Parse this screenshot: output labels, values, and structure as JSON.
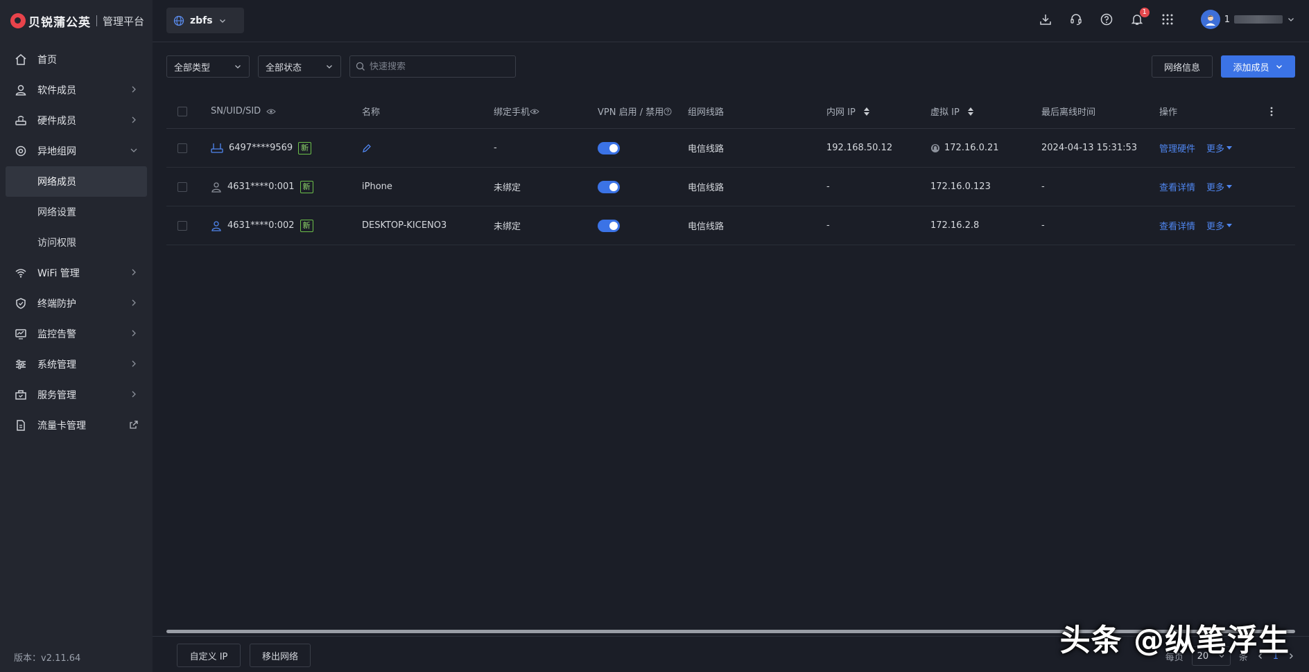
{
  "brand": {
    "name": "贝锐蒲公英",
    "subtitle": "管理平台"
  },
  "sidebar": {
    "items": [
      {
        "label": "首页",
        "icon": "home-icon"
      },
      {
        "label": "软件成员",
        "icon": "user-icon"
      },
      {
        "label": "硬件成员",
        "icon": "router-icon"
      },
      {
        "label": "异地组网",
        "icon": "network-icon"
      },
      {
        "label": "WiFi 管理",
        "icon": "wifi-icon"
      },
      {
        "label": "终端防护",
        "icon": "shield-icon"
      },
      {
        "label": "监控告警",
        "icon": "monitor-icon"
      },
      {
        "label": "系统管理",
        "icon": "settings-sliders-icon"
      },
      {
        "label": "服务管理",
        "icon": "service-icon"
      },
      {
        "label": "流量卡管理",
        "icon": "simcard-icon"
      }
    ],
    "sub_items": [
      {
        "label": "网络成员"
      },
      {
        "label": "网络设置"
      },
      {
        "label": "访问权限"
      }
    ],
    "version": "版本：v2.11.64"
  },
  "topbar": {
    "network_name": "zbfs",
    "notification_count": "1",
    "user_initial": "1"
  },
  "filters": {
    "type": "全部类型",
    "status": "全部状态",
    "search_placeholder": "快速搜索"
  },
  "actions": {
    "net_info": "网络信息",
    "add_member": "添加成员"
  },
  "table": {
    "headers": {
      "sn": "SN/UID/SID",
      "name": "名称",
      "phone": "绑定手机",
      "vpn": "VPN 启用 / 禁用",
      "line": "组网线路",
      "lan": "内网 IP",
      "vip": "虚拟 IP",
      "last": "最后离线时间",
      "ops": "操作"
    },
    "new_tag": "新",
    "more": "更多",
    "rows": [
      {
        "sn": "6497****9569",
        "name": "",
        "phone": "-",
        "vpn": true,
        "line": "电信线路",
        "lan": "192.168.50.12",
        "vip": "172.16.0.21",
        "last": "2024-04-13 15:31:53",
        "op": "管理硬件"
      },
      {
        "sn": "4631****0:001",
        "name": "iPhone",
        "phone": "未绑定",
        "vpn": true,
        "line": "电信线路",
        "lan": "-",
        "vip": "172.16.0.123",
        "last": "-",
        "op": "查看详情"
      },
      {
        "sn": "4631****0:002",
        "name": "DESKTOP-KICENO3",
        "phone": "未绑定",
        "vpn": true,
        "line": "电信线路",
        "lan": "-",
        "vip": "172.16.2.8",
        "last": "-",
        "op": "查看详情"
      }
    ]
  },
  "footer": {
    "custom_ip": "自定义 IP",
    "move_out": "移出网络",
    "per_page_label": "每页",
    "page_size": "20",
    "unit": "条",
    "current_page": "1"
  },
  "watermark": "头条 @纵笔浮生",
  "colors": {
    "accent": "#3b73e6",
    "link": "#4f86f0",
    "new_tag": "#8ed66b",
    "badge": "#e5484d"
  }
}
